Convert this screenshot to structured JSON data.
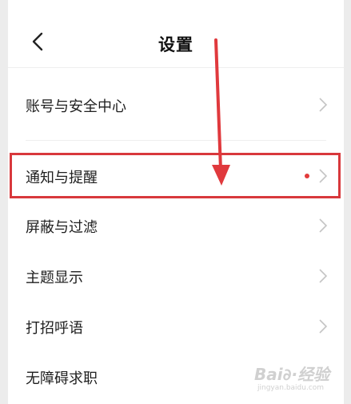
{
  "header": {
    "title": "设置",
    "back_icon": "chevron-left-icon"
  },
  "menu": {
    "items": [
      {
        "label": "账号与安全中心"
      },
      {
        "label": "通知与提醒",
        "has_badge": true
      },
      {
        "label": "屏蔽与过滤"
      },
      {
        "label": "主题显示"
      },
      {
        "label": "打招呼语"
      },
      {
        "label": "无障碍求职"
      }
    ]
  },
  "annotation": {
    "highlight_color": "#d8383c",
    "arrow_color": "#e0393d"
  },
  "watermark": {
    "brand": "Bai∂·经验",
    "url": "jingyan.baidu.com"
  }
}
